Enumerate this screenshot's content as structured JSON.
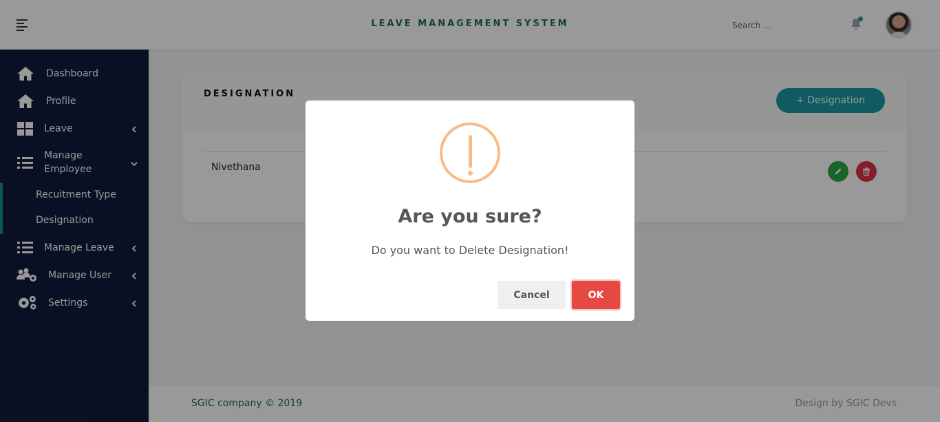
{
  "header": {
    "app_title": "LEAVE MANAGEMENT SYSTEM",
    "search_placeholder": "Search ...",
    "notification_dot_color": "#1a9aa0"
  },
  "sidebar": {
    "items": [
      {
        "label": "Dashboard",
        "icon": "home-icon"
      },
      {
        "label": "Profile",
        "icon": "home-icon"
      },
      {
        "label": "Leave",
        "icon": "grid-icon",
        "chevron": "left"
      },
      {
        "label": "Manage\nEmployee",
        "icon": "list-icon",
        "chevron": "down"
      },
      {
        "label": "Manage Leave",
        "icon": "list-icon",
        "chevron": "left"
      },
      {
        "label": "Manage User",
        "icon": "users-gear-icon",
        "chevron": "left"
      },
      {
        "label": "Settings",
        "icon": "gears-icon",
        "chevron": "left"
      }
    ],
    "sub_items": [
      "Recuitment Type",
      "Designation"
    ]
  },
  "card": {
    "title": "DESIGNATION",
    "add_button": "+ Designation",
    "rows": [
      {
        "name": "Nivethana"
      }
    ]
  },
  "footer": {
    "left": "SGIC company © 2019",
    "right": "Design by SGIC Devs"
  },
  "modal": {
    "title": "Are you sure?",
    "text": "Do you want to Delete Designation!",
    "cancel": "Cancel",
    "ok": "OK",
    "icon": "warning-icon"
  },
  "colors": {
    "sidebar_bg": "#111c3b",
    "accent_teal": "#1b97a3",
    "ok_red": "#e64942",
    "warning_orange": "#f8bb86",
    "edit_green": "#28a745",
    "delete_red": "#dc3545"
  }
}
